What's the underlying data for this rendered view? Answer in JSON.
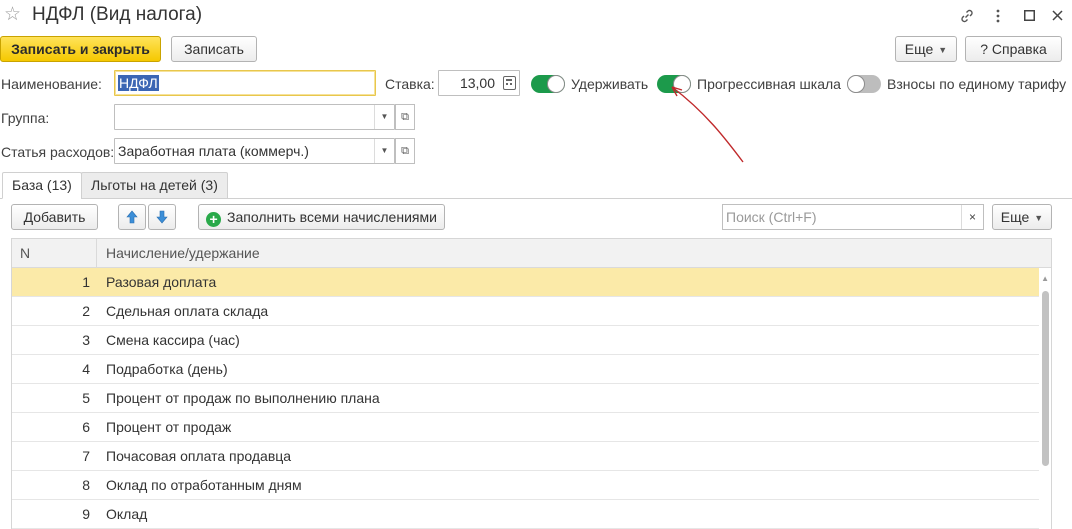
{
  "window": {
    "title": "НДФЛ (Вид налога)",
    "star_icon": "star-icon",
    "link_icon": "link-icon",
    "menu_icon": "more-vertical-icon",
    "maximize_icon": "maximize-icon",
    "close_icon": "close-icon"
  },
  "toolbar": {
    "save_close_label": "Записать и закрыть",
    "save_label": "Записать",
    "more_label": "Еще",
    "help_label": "Справка",
    "help_prefix": "?"
  },
  "form": {
    "name_label": "Наименование:",
    "name_value": "НДФЛ",
    "rate_label": "Ставка:",
    "rate_value": "13,00",
    "group_label": "Группа:",
    "group_value": "",
    "expense_label": "Статья расходов:",
    "expense_value": "Заработная плата (коммерч.)",
    "toggles": [
      {
        "label": "Удерживать",
        "on": true
      },
      {
        "label": "Прогрессивная шкала",
        "on": true
      },
      {
        "label": "Взносы по единому тарифу",
        "on": false
      }
    ]
  },
  "tabs": [
    {
      "label": "База (13)",
      "active": true
    },
    {
      "label": "Льготы на детей (3)",
      "active": false
    }
  ],
  "table_toolbar": {
    "add_label": "Добавить",
    "fill_label": "Заполнить всеми начислениями",
    "search_placeholder": "Поиск (Ctrl+F)",
    "more_label": "Еще",
    "clear_symbol": "×"
  },
  "table": {
    "columns": [
      "N",
      "Начисление/удержание"
    ],
    "rows": [
      {
        "n": "1",
        "name": "Разовая доплата",
        "selected": true
      },
      {
        "n": "2",
        "name": "Сдельная оплата склада",
        "selected": false
      },
      {
        "n": "3",
        "name": "Смена кассира (час)",
        "selected": false
      },
      {
        "n": "4",
        "name": "Подработка (день)",
        "selected": false
      },
      {
        "n": "5",
        "name": "Процент от продаж по выполнению плана",
        "selected": false
      },
      {
        "n": "6",
        "name": "Процент от продаж",
        "selected": false
      },
      {
        "n": "7",
        "name": "Почасовая оплата продавца",
        "selected": false
      },
      {
        "n": "8",
        "name": "Оклад по отработанным дням",
        "selected": false
      },
      {
        "n": "9",
        "name": "Оклад",
        "selected": false
      }
    ]
  },
  "colors": {
    "primary_button": "#f5c800",
    "toggle_on": "#1c9a4b",
    "toggle_off": "#bdbdbd",
    "selected_row": "#fbeaa8",
    "annotation_arrow": "#c0292b"
  }
}
